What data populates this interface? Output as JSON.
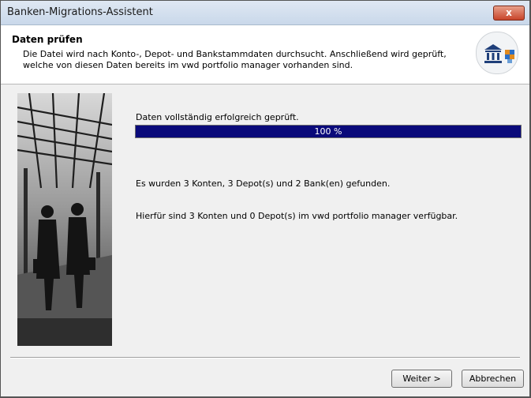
{
  "window": {
    "title": "Banken-Migrations-Assistent",
    "close_label": "x"
  },
  "header": {
    "title": "Daten prüfen",
    "description": "Die Datei wird nach Konto-, Depot- und Bankstammdaten durchsucht. Anschließend wird geprüft, welche von diesen Daten bereits im vwd portfolio manager vorhanden sind."
  },
  "main": {
    "status": "Daten vollständig erfolgreich geprüft.",
    "progress": {
      "value": 100,
      "label": "100 %"
    },
    "result_found": "Es wurden 3 Konten, 3 Depot(s) und 2 Bank(en) gefunden.",
    "result_available": "Hierfür sind 3 Konten und 0 Depot(s) im vwd portfolio manager verfügbar."
  },
  "buttons": {
    "next": "Weiter >",
    "cancel": "Abbrechen"
  },
  "colors": {
    "progress_fill": "#0a0a7a",
    "title_bar": "#c9d8ea",
    "close_button": "#c8442a"
  }
}
